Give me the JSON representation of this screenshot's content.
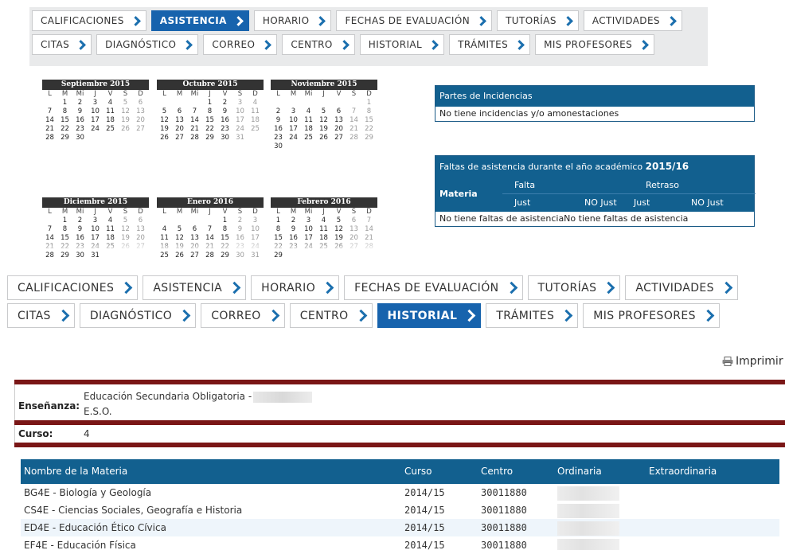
{
  "nav_top": {
    "tabs": [
      {
        "label": "CALIFICACIONES",
        "active": false
      },
      {
        "label": "ASISTENCIA",
        "active": true
      },
      {
        "label": "HORARIO",
        "active": false
      },
      {
        "label": "FECHAS DE EVALUACIÓN",
        "active": false
      },
      {
        "label": "TUTORÍAS",
        "active": false
      },
      {
        "label": "ACTIVIDADES",
        "active": false
      },
      {
        "label": "CITAS",
        "active": false
      },
      {
        "label": "DIAGNÓSTICO",
        "active": false
      },
      {
        "label": "CORREO",
        "active": false
      },
      {
        "label": "CENTRO",
        "active": false
      },
      {
        "label": "HISTORIAL",
        "active": false
      },
      {
        "label": "TRÁMITES",
        "active": false
      },
      {
        "label": "MIS PROFESORES",
        "active": false
      }
    ]
  },
  "nav_bottom": {
    "tabs": [
      {
        "label": "CALIFICACIONES",
        "active": false
      },
      {
        "label": "ASISTENCIA",
        "active": false
      },
      {
        "label": "HORARIO",
        "active": false
      },
      {
        "label": "FECHAS DE EVALUACIÓN",
        "active": false
      },
      {
        "label": "TUTORÍAS",
        "active": false
      },
      {
        "label": "ACTIVIDADES",
        "active": false
      },
      {
        "label": "CITAS",
        "active": false
      },
      {
        "label": "DIAGNÓSTICO",
        "active": false
      },
      {
        "label": "CORREO",
        "active": false
      },
      {
        "label": "CENTRO",
        "active": false
      },
      {
        "label": "HISTORIAL",
        "active": true
      },
      {
        "label": "TRÁMITES",
        "active": false
      },
      {
        "label": "MIS PROFESORES",
        "active": false
      }
    ]
  },
  "calendar": {
    "weekdays": [
      "L",
      "M",
      "Mi",
      "J",
      "V",
      "S",
      "D"
    ],
    "months": [
      {
        "title": "Septiembre 2015",
        "offset": 1,
        "days": 30
      },
      {
        "title": "Octubre 2015",
        "offset": 3,
        "days": 31
      },
      {
        "title": "Noviembre 2015",
        "offset": 6,
        "days": 30
      },
      {
        "title": "Diciembre 2015",
        "offset": 1,
        "days": 31
      },
      {
        "title": "Enero 2016",
        "offset": 4,
        "days": 31
      },
      {
        "title": "Febrero 2016",
        "offset": 0,
        "days": 29
      }
    ]
  },
  "incidencias": {
    "title": "Partes de Incidencias",
    "message": "No tiene incidencias y/o amonestaciones"
  },
  "faltas": {
    "title_prefix": "Faltas de asistencia durante el año académico",
    "year": "2015/16",
    "col_materia": "Materia",
    "col_falta": "Falta",
    "col_retraso": "Retraso",
    "sub_just": "Just",
    "sub_nojust": "NO Just",
    "message": "No tiene faltas de asistenciaNo tiene faltas de asistencia"
  },
  "print": {
    "label": "Imprimir"
  },
  "historial": {
    "ensenanza_label": "Enseñanza:",
    "ensenanza_line1": "Educación Secundaria Obligatoria -",
    "ensenanza_line2": "E.S.O.",
    "curso_label": "Curso:",
    "curso_value": "4"
  },
  "materias": {
    "headers": [
      "Nombre de la Materia",
      "Curso",
      "Centro",
      "Ordinaria",
      "Extraordinaria"
    ],
    "rows": [
      {
        "nombre": "BG4E - Biología y Geología",
        "curso": "2014/15",
        "centro": "30011880"
      },
      {
        "nombre": "CS4E - Ciencias Sociales, Geografía e Historia",
        "curso": "2014/15",
        "centro": "30011880"
      },
      {
        "nombre": "ED4E - Educación Ético Cívica",
        "curso": "2014/15",
        "centro": "30011880"
      },
      {
        "nombre": "EF4E - Educación Física",
        "curso": "2014/15",
        "centro": "30011880"
      }
    ]
  },
  "colors": {
    "accent": "#1763ad",
    "table_header": "#12608f",
    "dark_red": "#7a1616",
    "nav_bg": "#e9eaeb"
  },
  "icons": {
    "tab_chevron": "chevron-right-icon",
    "print": "printer-icon"
  }
}
